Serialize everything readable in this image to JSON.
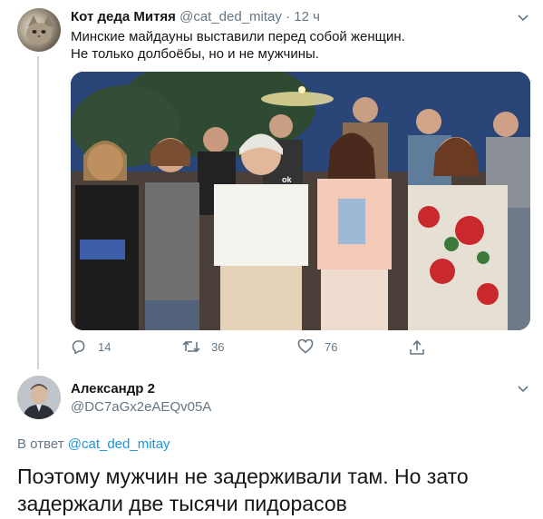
{
  "tweet1": {
    "author_name": "Кот деда Митяя",
    "author_handle": "@cat_ded_mitay",
    "separator": "·",
    "time": "12 ч",
    "text_line1": "Минские майдауны выставили перед собой женщин.",
    "text_line2": "Не только долбоёбы, но и не мужчины.",
    "image_caption_logo": "ok",
    "actions": {
      "reply_count": "14",
      "retweet_count": "36",
      "like_count": "76"
    }
  },
  "tweet2": {
    "author_name": "Александр 2",
    "author_handle": "@DC7aGx2eAEQv05A",
    "reply_prefix": "В ответ",
    "reply_to_handle": "@cat_ded_mitay",
    "text_line1": "Поэтому мужчин не задерживали там. Но зато",
    "text_line2": "задержали две тысячи пидорасов"
  },
  "colors": {
    "text_primary": "#14171a",
    "text_secondary": "#657786",
    "link": "#1b95e0",
    "thread_line": "#ccd6dd"
  },
  "icons": [
    "chevron-down-icon",
    "reply-icon",
    "retweet-icon",
    "like-icon",
    "share-icon"
  ]
}
